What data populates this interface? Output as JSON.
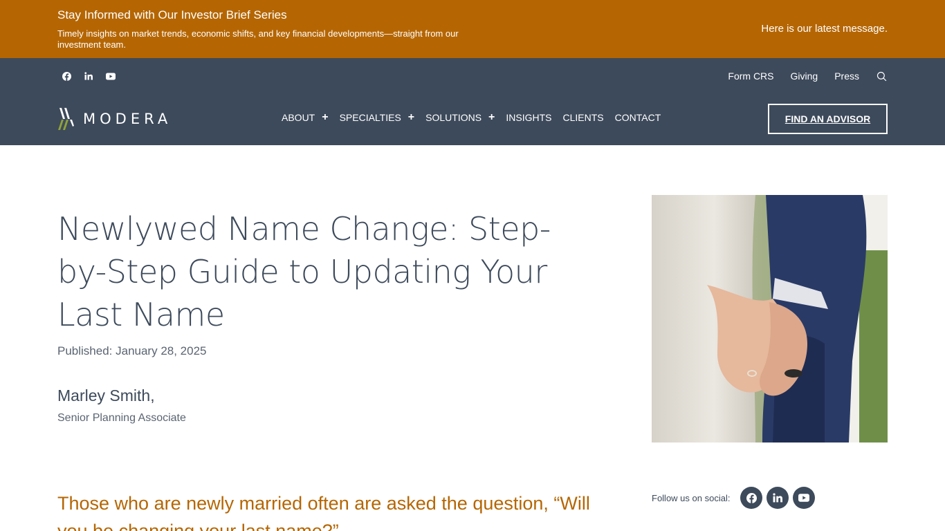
{
  "banner": {
    "title": "Stay Informed with Our Investor Brief Series",
    "subtitle": "Timely insights on market trends, economic shifts, and key financial developments—straight from our investment team.",
    "link": "Here is our latest message."
  },
  "header": {
    "social_icons": [
      "facebook-icon",
      "linkedin-icon",
      "youtube-icon"
    ],
    "utility_links": [
      "Form CRS",
      "Giving",
      "Press"
    ],
    "logo_text": "MODERA",
    "nav": [
      {
        "label": "ABOUT",
        "has_submenu": true
      },
      {
        "label": "SPECIALTIES",
        "has_submenu": true
      },
      {
        "label": "SOLUTIONS",
        "has_submenu": true
      },
      {
        "label": "INSIGHTS",
        "has_submenu": false
      },
      {
        "label": "CLIENTS",
        "has_submenu": false
      },
      {
        "label": "CONTACT",
        "has_submenu": false
      }
    ],
    "plus_symbol": "+",
    "cta": "FIND AN ADVISOR"
  },
  "article": {
    "title": "Newlywed Name Change: Step-by-Step Guide to Updating Your Last Name",
    "published": "Published: January 28, 2025",
    "author_name": "Marley Smith,",
    "author_role": "Senior Planning Associate",
    "lead": "Those who are newly married often are asked the question, “Will you be changing your last name?”"
  },
  "sidebar": {
    "follow_label": "Follow us on social:",
    "social_icons": [
      "facebook-icon",
      "linkedin-icon",
      "youtube-icon"
    ]
  },
  "colors": {
    "banner": "#b56603",
    "header": "#3d4a5b",
    "accent_text": "#b56603",
    "logo_green": "#8fa33a"
  }
}
